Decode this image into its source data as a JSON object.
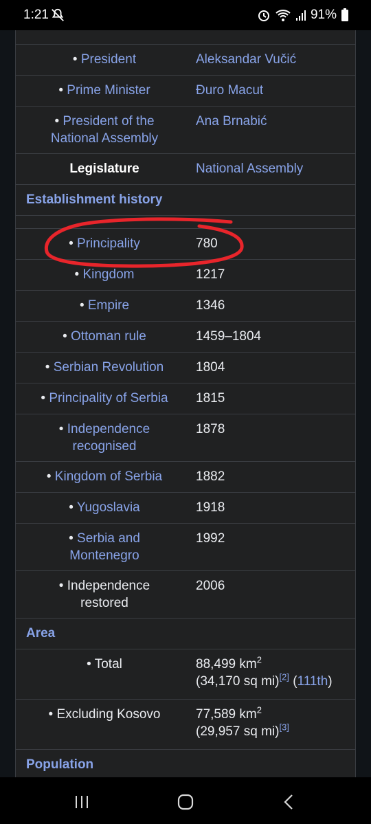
{
  "status_bar": {
    "time": "1:21",
    "battery": "91%",
    "icons": [
      "mute-icon",
      "alarm-icon",
      "wifi-icon",
      "signal-icon",
      "battery-icon"
    ]
  },
  "infobox": {
    "leaders": [
      {
        "label": "President",
        "value": "Aleksandar Vučić"
      },
      {
        "label": "Prime Minister",
        "value": "Đuro Macut"
      },
      {
        "label_line1": "President of the",
        "label_line2": "National Assembly",
        "value": "Ana Brnabić"
      }
    ],
    "legislature": {
      "label": "Legislature",
      "value": "National Assembly"
    },
    "establishment": {
      "heading": "Establishment history",
      "events": [
        {
          "label": "Principality",
          "value": "780"
        },
        {
          "label": "Kingdom",
          "value": "1217"
        },
        {
          "label": "Empire",
          "value": "1346"
        },
        {
          "label": "Ottoman rule",
          "value": "1459–1804"
        },
        {
          "label": "Serbian Revolution",
          "value": "1804"
        },
        {
          "label": "Principality of Serbia",
          "value": "1815"
        },
        {
          "label_line1": "Independence",
          "label_line2": "recognised",
          "value": "1878"
        },
        {
          "label": "Kingdom of Serbia",
          "value": "1882"
        },
        {
          "label": "Yugoslavia",
          "value": "1918"
        },
        {
          "label_line1": "Serbia and",
          "label_line2": "Montenegro",
          "value": "1992"
        },
        {
          "label_line1": "Independence",
          "label_line2": "restored",
          "value": "2006"
        }
      ]
    },
    "area": {
      "heading": "Area",
      "total": {
        "label": "Total",
        "line1": "88,499 km",
        "sup1": "2",
        "line2_open": "(34,170 sq mi)",
        "ref": "[2]",
        "rank": "111th",
        "line2_close": ")"
      },
      "excluding": {
        "label": "Excluding Kosovo",
        "line1": "77,589 km",
        "sup1": "2",
        "line2": "(29,957 sq mi)",
        "ref": "[3]"
      }
    },
    "population": {
      "heading": "Population"
    }
  },
  "annotation": {
    "color": "#e8252b",
    "circled_item": "Principality"
  }
}
